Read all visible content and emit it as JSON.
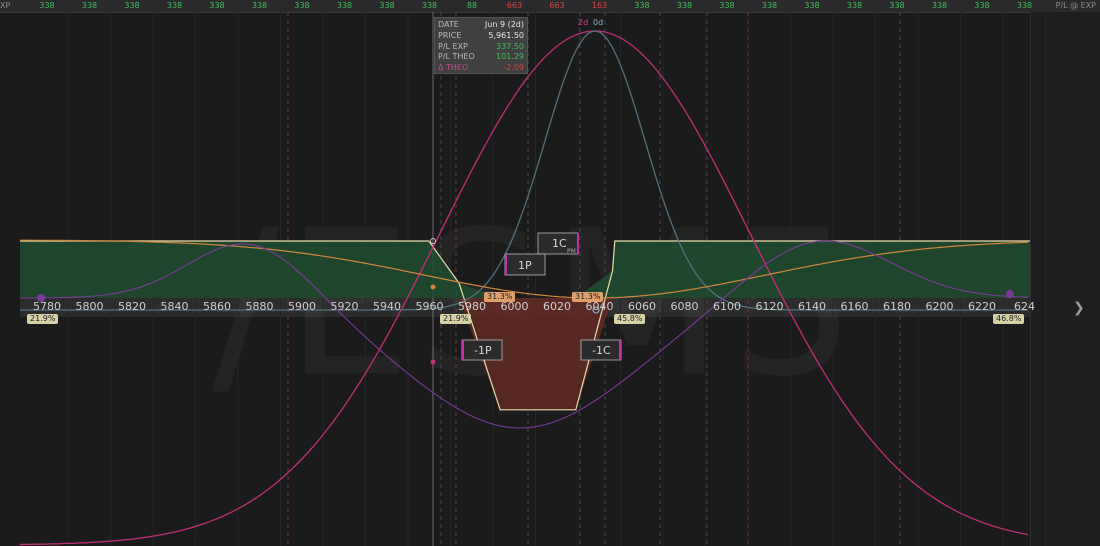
{
  "header": {
    "left_label": "XP",
    "right_label": "P/L @ EXP",
    "values": [
      {
        "text": "338",
        "color": "#3fbf5a"
      },
      {
        "text": "338",
        "color": "#3fbf5a"
      },
      {
        "text": "338",
        "color": "#3fbf5a"
      },
      {
        "text": "338",
        "color": "#3fbf5a"
      },
      {
        "text": "338",
        "color": "#3fbf5a"
      },
      {
        "text": "338",
        "color": "#3fbf5a"
      },
      {
        "text": "338",
        "color": "#3fbf5a"
      },
      {
        "text": "338",
        "color": "#3fbf5a"
      },
      {
        "text": "338",
        "color": "#3fbf5a"
      },
      {
        "text": "338",
        "color": "#3fbf5a"
      },
      {
        "text": "88",
        "color": "#3fbf5a"
      },
      {
        "text": "663",
        "color": "#e04040"
      },
      {
        "text": "663",
        "color": "#e04040"
      },
      {
        "text": "163",
        "color": "#e04040"
      },
      {
        "text": "338",
        "color": "#3fbf5a"
      },
      {
        "text": "338",
        "color": "#3fbf5a"
      },
      {
        "text": "338",
        "color": "#3fbf5a"
      },
      {
        "text": "338",
        "color": "#3fbf5a"
      },
      {
        "text": "338",
        "color": "#3fbf5a"
      },
      {
        "text": "338",
        "color": "#3fbf5a"
      },
      {
        "text": "338",
        "color": "#3fbf5a"
      },
      {
        "text": "338",
        "color": "#3fbf5a"
      },
      {
        "text": "338",
        "color": "#3fbf5a"
      },
      {
        "text": "338",
        "color": "#3fbf5a"
      }
    ]
  },
  "watermark": "/ESM5",
  "tooltip": {
    "date_label": "DATE",
    "date_value": "Jun 9 (2d)",
    "price_label": "PRICE",
    "price_value": "5,961.50",
    "plexp_label": "P/L EXP",
    "plexp_value": "337.50",
    "pltheo_label": "P/L THEO",
    "pltheo_value": "101.29",
    "theo_label": "Δ THEO",
    "theo_value": "-2.09"
  },
  "legend": {
    "series_2d": "2d",
    "series_0d": "0d"
  },
  "axis": {
    "ticks": [
      "5780",
      "5800",
      "5820",
      "5840",
      "5860",
      "5880",
      "5900",
      "5920",
      "5940",
      "5960",
      "5980",
      "6000",
      "6020",
      "6040",
      "6060",
      "6080",
      "6100",
      "6120",
      "6140",
      "6160",
      "6180",
      "6200",
      "6220",
      "624"
    ]
  },
  "badges": {
    "left_prob": "21.9%",
    "lower_be_prob": "21.9%",
    "upper_be_prob": "45.8%",
    "right_prob": "46.8%",
    "lower_strike": "31.3%",
    "upper_strike": "31.3%"
  },
  "legs": {
    "long_call": "1C",
    "long_call_sub": "PM",
    "long_put": "1P",
    "short_put": "-1P",
    "short_call": "-1C"
  },
  "colors": {
    "profit_fill": "#1f4d30",
    "loss_fill": "#5e2a22",
    "pl_exp_line": "#e8d9a8",
    "theo_2d": "#c42f77",
    "theo_0d": "#55707c",
    "delta": "#d2863a",
    "theta": "#7a3a9a"
  },
  "chart_data": {
    "type": "line",
    "x_range": [
      5773,
      6240
    ],
    "pl_at_expiration": {
      "x": [
        5773,
        5962,
        5976,
        5995,
        6010,
        6030,
        6047,
        6048,
        6240
      ],
      "y": [
        338,
        338,
        88,
        -663,
        -663,
        -663,
        163,
        338,
        338
      ]
    },
    "strikes": [
      5964,
      5995,
      6025,
      6047
    ],
    "current_price": 5961.5
  }
}
